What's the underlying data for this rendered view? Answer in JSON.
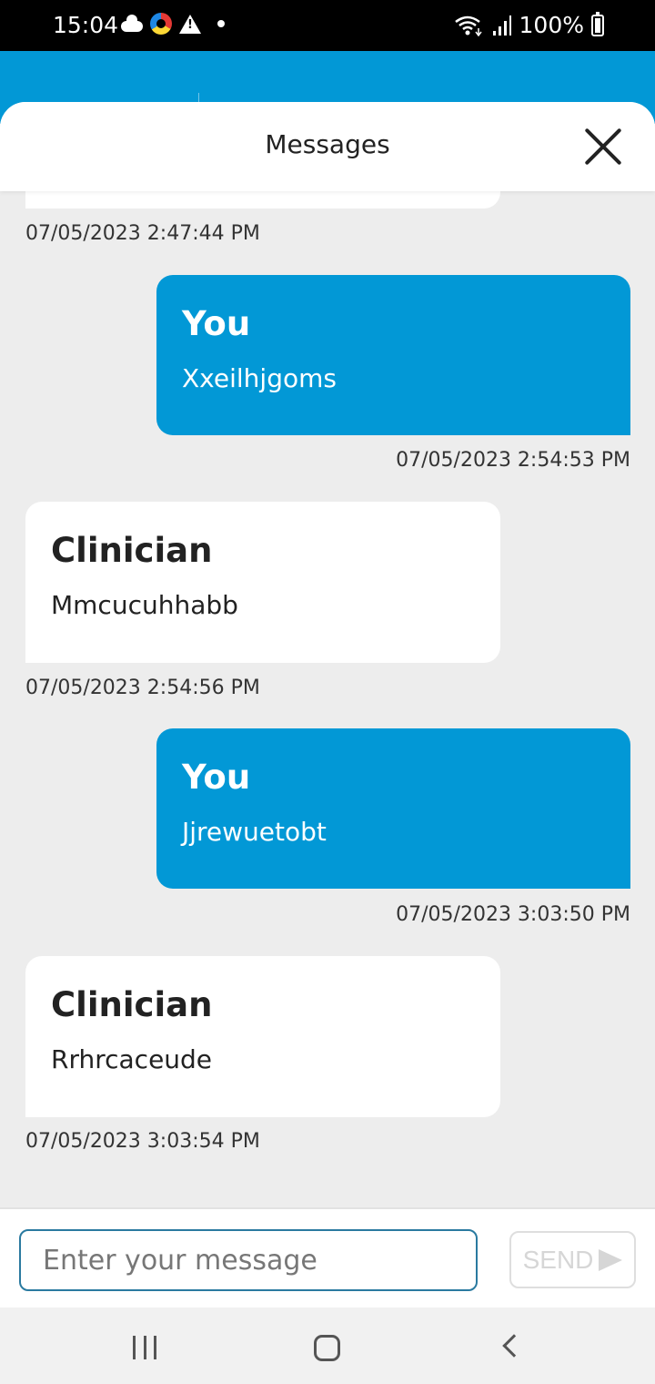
{
  "status_bar": {
    "time": "15:04",
    "battery": "100%",
    "icons": [
      "cloud-icon",
      "app-icon",
      "warning-icon",
      "dot-icon",
      "wifi-icon",
      "signal-icon",
      "battery-charging-icon"
    ]
  },
  "sheet": {
    "title": "Messages"
  },
  "messages": [
    {
      "sender": "You",
      "text": "Xxeilhjgoms",
      "timestamp": "07/05/2023 2:54:53 PM"
    },
    {
      "sender": "Clinician",
      "text": "Mmcucuhhabb",
      "timestamp": "07/05/2023 2:54:56 PM"
    },
    {
      "sender": "You",
      "text": "Jjrewuetobt",
      "timestamp": "07/05/2023 3:03:50 PM"
    },
    {
      "sender": "Clinician",
      "text": "Rrhrcaceude",
      "timestamp": "07/05/2023 3:03:54 PM"
    }
  ],
  "partial_message": {
    "timestamp": "07/05/2023 2:47:44 PM"
  },
  "composer": {
    "placeholder": "Enter your message",
    "value": "",
    "send_label": "SEND"
  },
  "colors": {
    "brand_blue": "#0298d6",
    "background": "#ededed"
  }
}
